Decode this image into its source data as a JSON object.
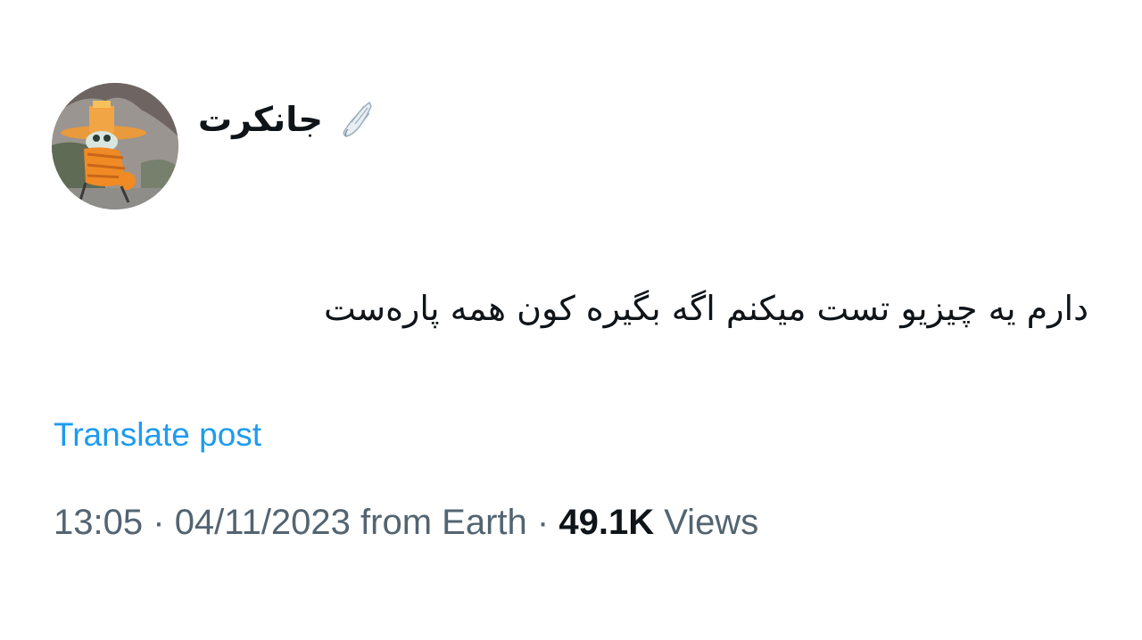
{
  "author": {
    "display_name": "جانکرت",
    "badge_icon": "wing-icon",
    "avatar_icon": "cartoon-character-avatar"
  },
  "post": {
    "text": "دارم یه چیزیو تست میکنم اگه بگیره کون همه پاره‌ست"
  },
  "actions": {
    "translate_label": "Translate post"
  },
  "meta": {
    "time": "13:05",
    "separator": "·",
    "date": "04/11/2023",
    "source": "from Earth",
    "views_count": "49.1K",
    "views_label": "Views"
  },
  "colors": {
    "text_primary": "#0f1419",
    "text_secondary": "#536471",
    "link": "#1d9bf0",
    "background": "#ffffff"
  }
}
